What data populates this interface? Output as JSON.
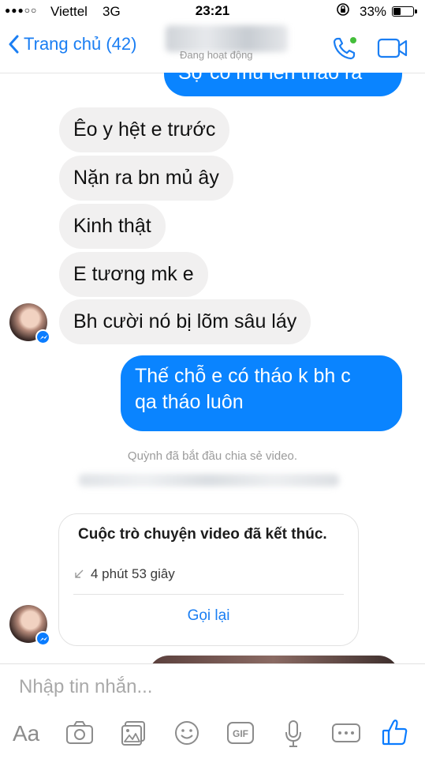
{
  "status_bar": {
    "signal": "●●●○○",
    "carrier": "Viettel",
    "network": "3G",
    "time": "23:21",
    "battery_percent": "33%",
    "battery_level": 0.33
  },
  "header": {
    "back_label": "Trang chủ (42)",
    "active_status": "Đang hoạt động",
    "accent_color": "#1a7ef3"
  },
  "messages": [
    {
      "direction": "outgoing",
      "text": "Sợ có mủ lên tháo ra"
    },
    {
      "direction": "incoming",
      "text": "Êo y hệt e trước"
    },
    {
      "direction": "incoming",
      "text": "Nặn ra bn mủ ây"
    },
    {
      "direction": "incoming",
      "text": "Kinh thật"
    },
    {
      "direction": "incoming",
      "text": "E tương mk e"
    },
    {
      "direction": "incoming",
      "text": "Bh cười nó bị lõm sâu láy"
    },
    {
      "direction": "outgoing",
      "text": "Thế chỗ e có tháo k bh c\nqa tháo luôn"
    }
  ],
  "system_notice": "Quỳnh đã bắt đầu chia sẻ video.",
  "video_call_card": {
    "title": "Cuộc trò chuyện video đã kết thúc.",
    "duration": "4 phút 53 giây",
    "call_back_label": "Gọi lại"
  },
  "composer": {
    "placeholder": "Nhập tin nhắn...",
    "aa_label": "Aa",
    "gif_label": "GIF",
    "icons": [
      "camera-icon",
      "gallery-icon",
      "emoji-icon",
      "gif-icon",
      "microphone-icon",
      "more-icon",
      "like-icon"
    ]
  },
  "colors": {
    "outgoing_bubble": "#0a84ff",
    "incoming_bubble": "#f1f0f0",
    "toolbar_icon": "#8c8c8c",
    "like_icon": "#0a7cff"
  }
}
